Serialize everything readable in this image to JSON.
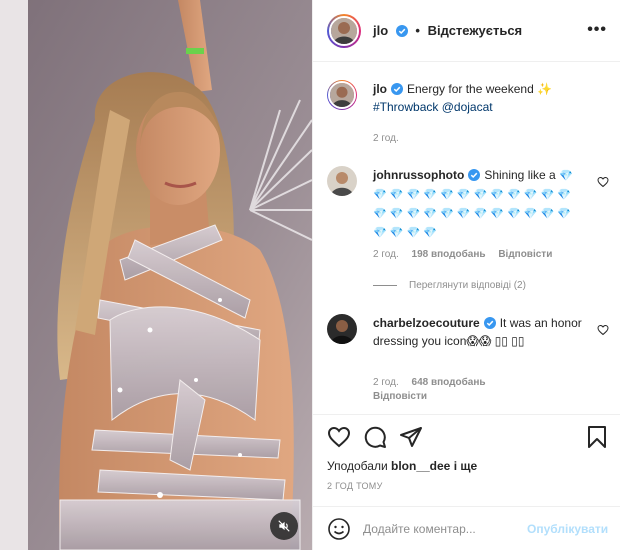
{
  "post": {
    "username": "jlo",
    "follow_status": "Відстежується",
    "more_icon": "more-horizontal-icon",
    "caption_text": "Energy for the weekend",
    "caption_emoji": "✨",
    "caption_hashtag": "#Throwback",
    "caption_mention": "@dojacat",
    "caption_time": "2 год."
  },
  "comments": [
    {
      "username": "johnrussophoto",
      "text": "Shining like a",
      "diamonds": "💎 💎 💎 💎 💎 💎 💎 💎 💎 💎 💎 💎 💎 💎 💎 💎 💎 💎 💎 💎 💎 💎 💎 💎 💎 💎 💎 💎 💎",
      "time": "2 год.",
      "likes": "198 вподобань",
      "reply": "Відповісти",
      "view_replies": "Переглянути відповіді (2)"
    },
    {
      "username": "charbelzoecouture",
      "text": "It was an honor dressing you icon😱😱 ▯▯ ▯▯",
      "time": "2 год.",
      "likes": "648 вподобань",
      "reply": "Відповісти"
    }
  ],
  "actions": {
    "liked_by_prefix": "Уподобали",
    "liked_by_user": "blon__dee",
    "liked_by_suffix": "і ще",
    "time_ago": "2 ГОД ТОМУ"
  },
  "composer": {
    "placeholder": "Додайте коментар...",
    "publish_label": "Опублікувати"
  },
  "colors": {
    "link": "#00376b",
    "verified": "#3897f0",
    "publish_disabled": "#b2dffc"
  }
}
